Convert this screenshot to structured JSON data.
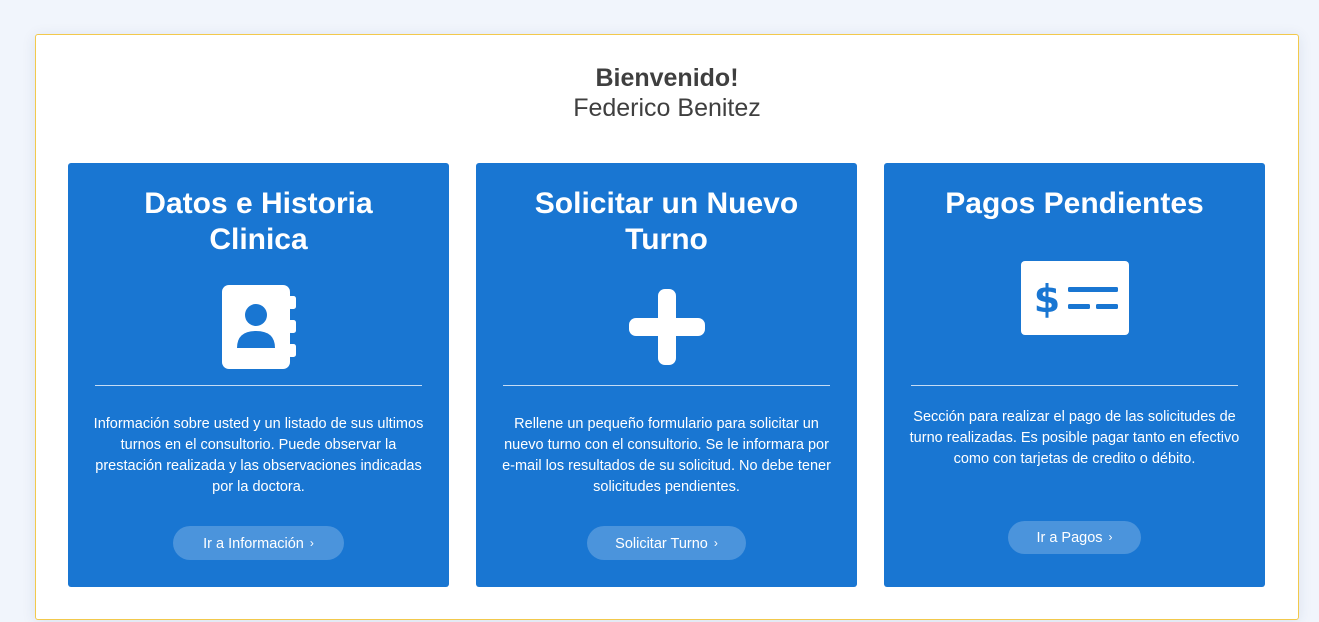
{
  "welcome": {
    "title": "Bienvenido!",
    "name": "Federico Benitez"
  },
  "colors": {
    "card_background": "#1976d2",
    "panel_border": "#f2c94c",
    "page_background": "#f1f5fc"
  },
  "cards": [
    {
      "title": "Datos e Historia Clinica",
      "icon": "address-book-icon",
      "description": "Información sobre usted y un listado de sus ultimos turnos en el consultorio. Puede observar la prestación realizada y las observaciones indicadas por la doctora.",
      "button": "Ir a Información"
    },
    {
      "title": "Solicitar un Nuevo Turno",
      "icon": "plus-icon",
      "description": "Rellene un pequeño formulario para solicitar un nuevo turno con el consultorio. Se le informara por e-mail los resultados de su solicitud. No debe tener solicitudes pendientes.",
      "button": "Solicitar Turno"
    },
    {
      "title": "Pagos Pendientes",
      "icon": "money-check-icon",
      "description": "Sección para realizar el pago de las solicitudes de turno realizadas. Es posible pagar tanto en efectivo como con tarjetas de credito o débito.",
      "button": "Ir a Pagos"
    }
  ]
}
